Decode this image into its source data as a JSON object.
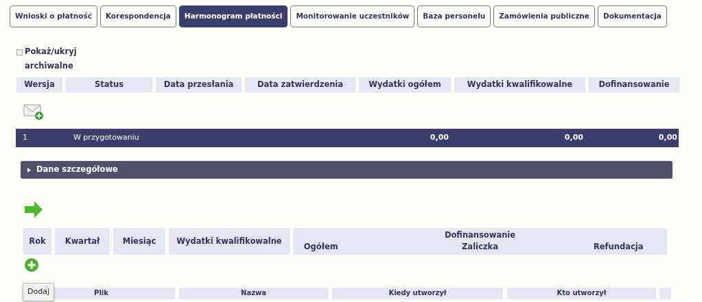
{
  "tabs": [
    {
      "label": "Wnioski o płatność",
      "selected": false
    },
    {
      "label": "Korespondencja",
      "selected": false
    },
    {
      "label": "Harmonogram płatności",
      "selected": true
    },
    {
      "label": "Monitorowanie uczestników",
      "selected": false
    },
    {
      "label": "Baza personelu",
      "selected": false
    },
    {
      "label": "Zamówienia publiczne",
      "selected": false
    },
    {
      "label": "Dokumentacja",
      "selected": false
    }
  ],
  "archive_toggle": {
    "label": "Pokaż/ukryj archiwalne",
    "checked": false
  },
  "versions_table": {
    "columns": [
      "Wersja",
      "Status",
      "Data przesłania",
      "Data zatwierdzenia",
      "Wydatki ogółem",
      "Wydatki kwalifikowalne",
      "Dofinansowanie"
    ],
    "rows": [
      {
        "wersja": "1",
        "status": "W przygotowaniu",
        "wydatki_ogolem": "0,00",
        "wydatki_kwalifikowalne": "0,00",
        "dofinansowanie": "0,00",
        "selected": true
      }
    ]
  },
  "details_panel": {
    "label": "Dane szczegółowe",
    "expanded": false
  },
  "schedule_table": {
    "columns": [
      "Rok",
      "Kwartał",
      "Miesiąc",
      "Wydatki kwalifikowalne"
    ],
    "group": {
      "label": "Dofinansowanie",
      "columns": [
        "Ogółem",
        "Zaliczka",
        "Refundacja"
      ]
    }
  },
  "add_tooltip": "Dodaj",
  "files_table": {
    "columns": [
      "Plik",
      "Nazwa",
      "Kiedy utworzył",
      "Kto utworzył"
    ]
  }
}
